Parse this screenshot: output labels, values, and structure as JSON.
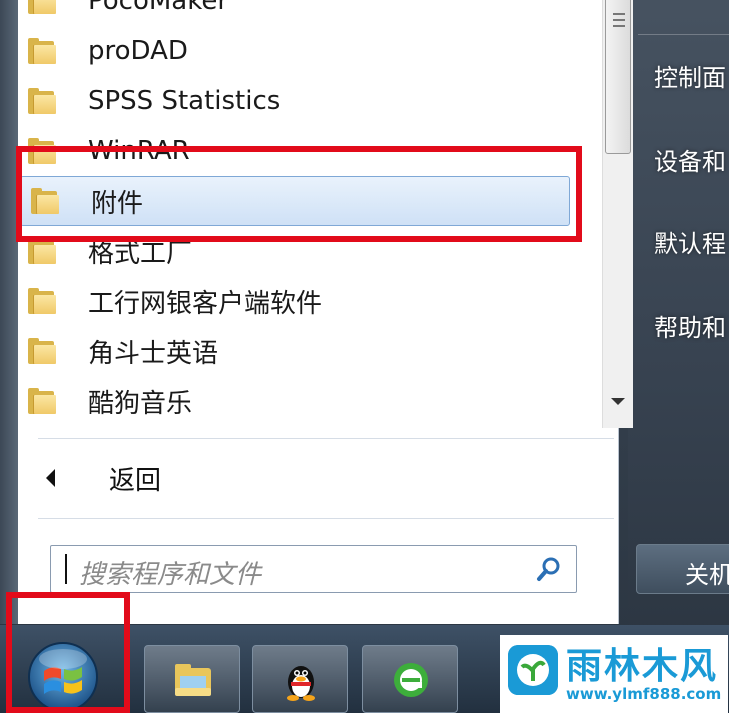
{
  "programs": [
    {
      "label": "PocoMaker"
    },
    {
      "label": "proDAD"
    },
    {
      "label": "SPSS Statistics"
    },
    {
      "label": "WinRAR"
    },
    {
      "label": "附件"
    },
    {
      "label": "格式工厂"
    },
    {
      "label": "工行网银客户端软件"
    },
    {
      "label": "角斗士英语"
    },
    {
      "label": "酷狗音乐"
    }
  ],
  "back_label": "返回",
  "search": {
    "placeholder": "搜索程序和文件"
  },
  "right_pane": {
    "items": [
      "控制面",
      "设备和",
      "默认程",
      "帮助和"
    ],
    "shutdown_label": "关机"
  },
  "watermark": {
    "title": "雨林木风",
    "url": "www.ylmf888.com"
  },
  "colors": {
    "highlight_border": "#e20b1a",
    "accent": "#1a9ad6"
  }
}
